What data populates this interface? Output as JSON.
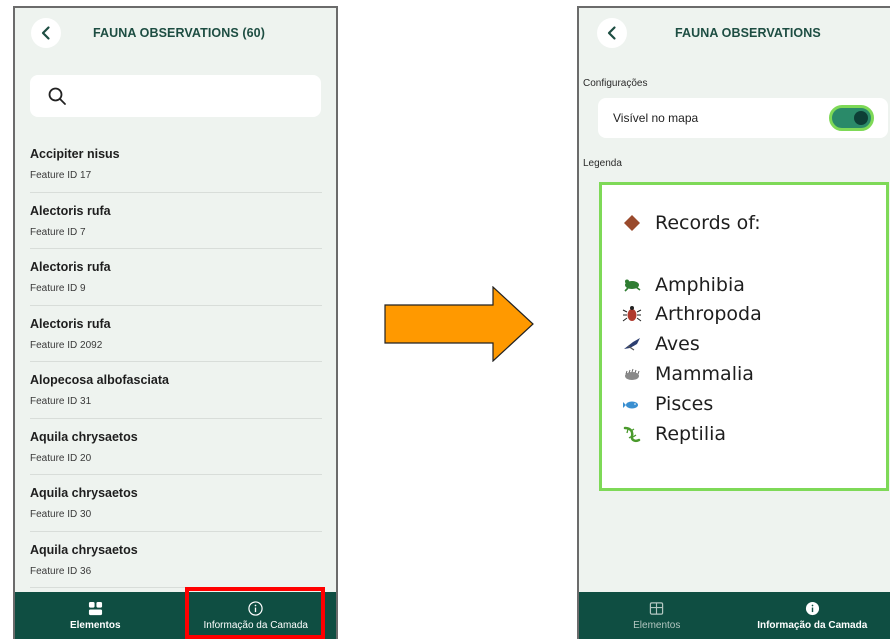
{
  "left_screen": {
    "title": "FAUNA OBSERVATIONS (60)",
    "search": {
      "value": "",
      "placeholder": ""
    },
    "observations": [
      {
        "name": "Accipiter nisus",
        "feature_id": "Feature ID 17"
      },
      {
        "name": "Alectoris rufa",
        "feature_id": "Feature ID 7"
      },
      {
        "name": "Alectoris rufa",
        "feature_id": "Feature ID 9"
      },
      {
        "name": "Alectoris rufa",
        "feature_id": "Feature ID 2092"
      },
      {
        "name": "Alopecosa albofasciata",
        "feature_id": "Feature ID 31"
      },
      {
        "name": "Aquila chrysaetos",
        "feature_id": "Feature ID 20"
      },
      {
        "name": "Aquila chrysaetos",
        "feature_id": "Feature ID 30"
      },
      {
        "name": "Aquila chrysaetos",
        "feature_id": "Feature ID 36"
      }
    ],
    "nav": {
      "tab1": "Elementos",
      "tab2": "Informação da Camada",
      "active": "Elementos"
    }
  },
  "right_screen": {
    "title": "FAUNA OBSERVATIONS",
    "settings_label": "Configurações",
    "visible_on_map_label": "Visível no mapa",
    "visible_on_map": true,
    "legend_label": "Legenda",
    "legend": {
      "header": "Records of:",
      "items": [
        {
          "label": "Amphibia",
          "icon": "frog-icon"
        },
        {
          "label": "Arthropoda",
          "icon": "beetle-icon"
        },
        {
          "label": "Aves",
          "icon": "bird-icon"
        },
        {
          "label": "Mammalia",
          "icon": "hedgehog-icon"
        },
        {
          "label": "Pisces",
          "icon": "fish-icon"
        },
        {
          "label": "Reptilia",
          "icon": "lizard-icon"
        }
      ]
    },
    "nav": {
      "tab1": "Elementos",
      "tab2": "Informação da Camada",
      "active": "Informação da Camada"
    }
  },
  "colors": {
    "primary_dark": "#0f4e42",
    "highlight_red": "#ff0000",
    "highlight_green": "#7ed957",
    "arrow_orange": "#ff9900"
  }
}
